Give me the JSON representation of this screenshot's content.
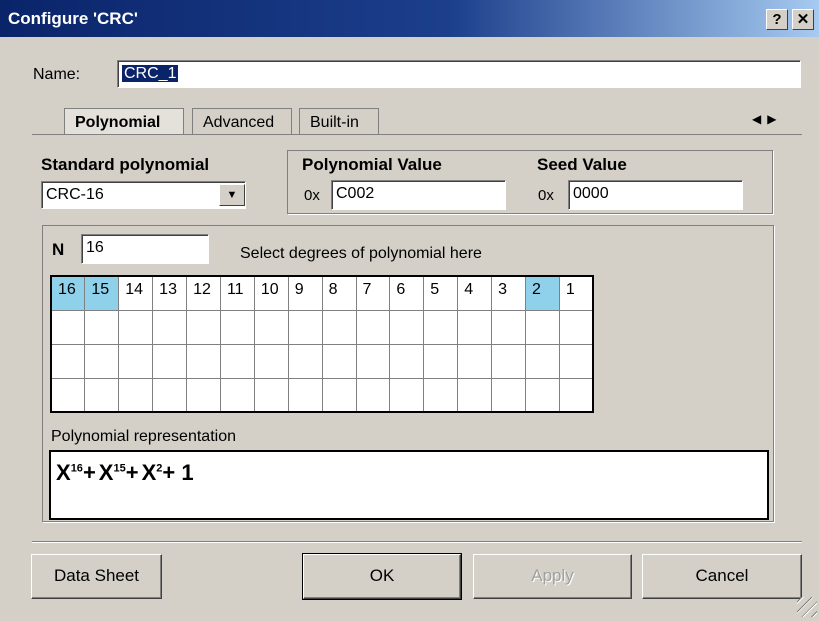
{
  "window": {
    "title": "Configure 'CRC'",
    "help_label": "?",
    "close_label": "✕"
  },
  "name_field": {
    "label": "Name:",
    "value": "CRC_1"
  },
  "tabs": [
    {
      "label": "Polynomial",
      "active": true
    },
    {
      "label": "Advanced",
      "active": false
    },
    {
      "label": "Built-in",
      "active": false
    }
  ],
  "tab_scroll": {
    "left": "◀",
    "right": "▶"
  },
  "standard_polynomial": {
    "label": "Standard polynomial",
    "selected": "CRC-16",
    "arrow": "▼"
  },
  "polynomial_value": {
    "label": "Polynomial Value",
    "prefix": "0x",
    "value": "C002"
  },
  "seed_value": {
    "label": "Seed Value",
    "prefix": "0x",
    "value": "0000"
  },
  "degree": {
    "label": "N",
    "value": "16",
    "hint": "Select degrees of polynomial  here"
  },
  "degree_grid": {
    "cells": [
      "16",
      "15",
      "14",
      "13",
      "12",
      "11",
      "10",
      "9",
      "8",
      "7",
      "6",
      "5",
      "4",
      "3",
      "2",
      "1"
    ],
    "selected": [
      "16",
      "15",
      "2"
    ],
    "empty_rows": 3
  },
  "polynomial_representation": {
    "label": "Polynomial representation",
    "terms": [
      {
        "base": "X",
        "exp": "16",
        "op": "+"
      },
      {
        "base": "X",
        "exp": "15",
        "op": "+"
      },
      {
        "base": "X",
        "exp": "2",
        "op": "+ 1"
      }
    ]
  },
  "buttons": {
    "datasheet": "Data Sheet",
    "ok": "OK",
    "apply": "Apply",
    "cancel": "Cancel"
  },
  "colors": {
    "title_bar": "#0a246a",
    "selected_cell": "#8fd0ea",
    "dialog_bg": "#d4d0c8"
  }
}
